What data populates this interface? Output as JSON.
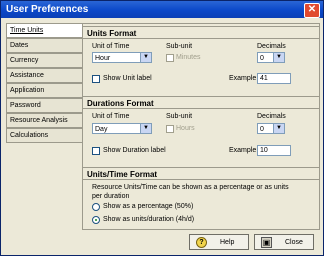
{
  "window": {
    "title": "User Preferences",
    "close_glyph": "✕"
  },
  "sidebar": {
    "items": [
      {
        "label": "Time Units",
        "active": true
      },
      {
        "label": "Dates"
      },
      {
        "label": "Currency"
      },
      {
        "label": "Assistance"
      },
      {
        "label": "Application"
      },
      {
        "label": "Password"
      },
      {
        "label": "Resource Analysis"
      },
      {
        "label": "Calculations"
      }
    ]
  },
  "units_format": {
    "heading": "Units Format",
    "unit_of_time_label": "Unit of Time",
    "unit_of_time_value": "Hour",
    "subunit_label": "Sub-unit",
    "subunit_option": "Minutes",
    "decimals_label": "Decimals",
    "decimals_value": "0",
    "show_unit_label": "Show Unit label",
    "example_label": "Example",
    "example_value": "41"
  },
  "durations_format": {
    "heading": "Durations Format",
    "unit_of_time_label": "Unit of Time",
    "unit_of_time_value": "Day",
    "subunit_label": "Sub-unit",
    "subunit_option": "Hours",
    "decimals_label": "Decimals",
    "decimals_value": "0",
    "show_duration_label": "Show Duration label",
    "example_label": "Example",
    "example_value": "10"
  },
  "units_time_format": {
    "heading": "Units/Time Format",
    "description": "Resource Units/Time can be shown as a percentage or as units per duration",
    "option_percentage": "Show as a percentage (50%)",
    "option_units": "Show as units/duration (4h/d)",
    "selected": "units"
  },
  "buttons": {
    "help": "Help",
    "close": "Close"
  },
  "icons": {
    "help": "help-icon",
    "close": "close-icon"
  },
  "colors": {
    "titlebar": "#0b48c9",
    "window_bg": "#ece9d8"
  }
}
